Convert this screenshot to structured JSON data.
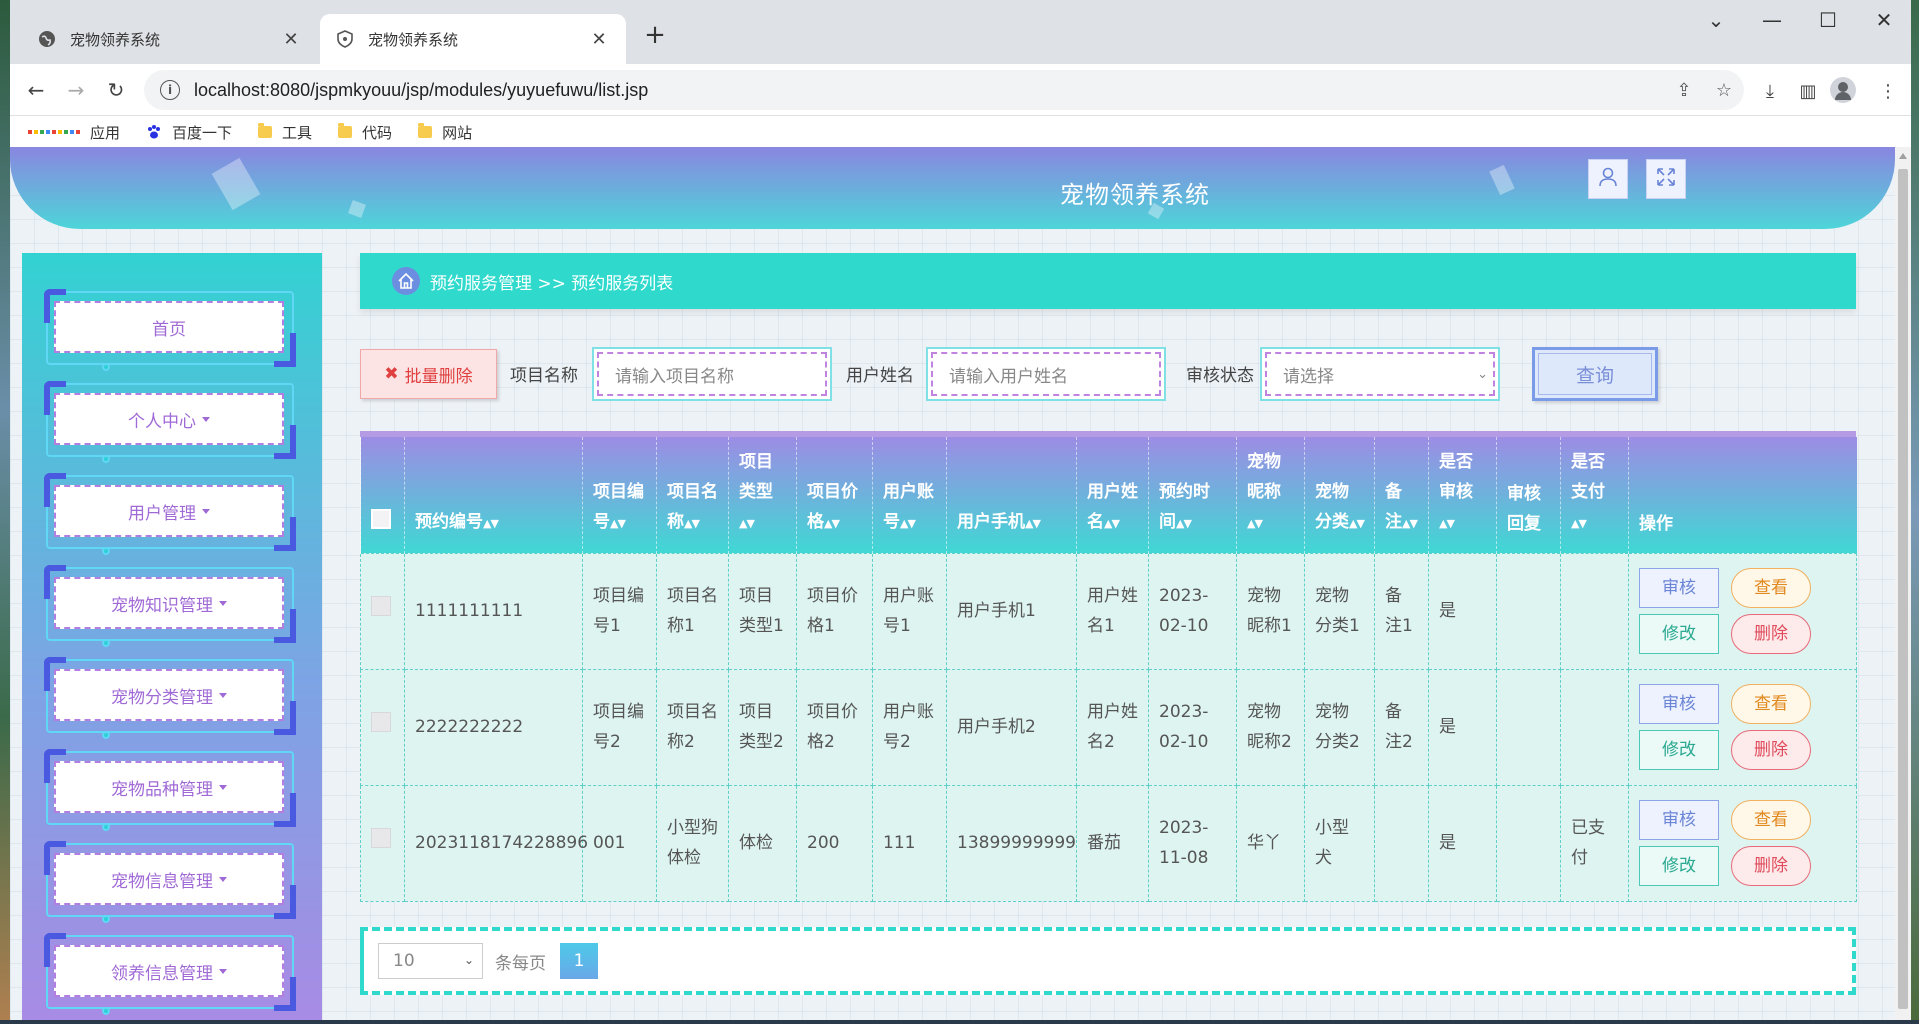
{
  "browser": {
    "tabs": [
      {
        "title": "宠物领养系统",
        "active": false
      },
      {
        "title": "宠物领养系统",
        "active": true
      }
    ],
    "url": "localhost:8080/jspmkyouu/jsp/modules/yuyuefuwu/list.jsp",
    "bookmarks": [
      "应用",
      "百度一下",
      "工具",
      "代码",
      "网站"
    ]
  },
  "app": {
    "title": "宠物领养系统"
  },
  "sidebar": {
    "items": [
      {
        "label": "首页",
        "dropdown": false
      },
      {
        "label": "个人中心",
        "dropdown": true
      },
      {
        "label": "用户管理",
        "dropdown": true
      },
      {
        "label": "宠物知识管理",
        "dropdown": true
      },
      {
        "label": "宠物分类管理",
        "dropdown": true
      },
      {
        "label": "宠物品种管理",
        "dropdown": true
      },
      {
        "label": "宠物信息管理",
        "dropdown": true
      },
      {
        "label": "领养信息管理",
        "dropdown": true
      }
    ]
  },
  "breadcrumb": {
    "text": "预约服务管理 >> 预约服务列表"
  },
  "search": {
    "batch_delete": "批量删除",
    "project_name_label": "项目名称",
    "project_name_placeholder": "请输入项目名称",
    "user_name_label": "用户姓名",
    "user_name_placeholder": "请输入用户姓名",
    "status_label": "审核状态",
    "status_placeholder": "请选择",
    "query_button": "查询"
  },
  "table": {
    "headers": [
      {
        "label": "预约编号",
        "sort": true
      },
      {
        "label": "项目编号",
        "sort": true
      },
      {
        "label": "项目名称",
        "sort": true
      },
      {
        "label": "项目类型",
        "sort": true
      },
      {
        "label": "项目价格",
        "sort": true
      },
      {
        "label": "用户账号",
        "sort": true
      },
      {
        "label": "用户手机",
        "sort": true
      },
      {
        "label": "用户姓名",
        "sort": true
      },
      {
        "label": "预约时间",
        "sort": true
      },
      {
        "label": "宠物昵称",
        "sort": true
      },
      {
        "label": "宠物分类",
        "sort": true
      },
      {
        "label": "备注",
        "sort": true
      },
      {
        "label": "是否审核",
        "sort": true
      },
      {
        "label": "审核回复",
        "sort": false
      },
      {
        "label": "是否支付",
        "sort": true
      },
      {
        "label": "操作",
        "sort": false
      }
    ],
    "rows": [
      [
        "1111111111",
        "项目编号1",
        "项目名称1",
        "项目类型1",
        "项目价格1",
        "用户账号1",
        "用户手机1",
        "用户姓名1",
        "2023-02-10",
        "宠物昵称1",
        "宠物分类1",
        "备注1",
        "是",
        "",
        ""
      ],
      [
        "2222222222",
        "项目编号2",
        "项目名称2",
        "项目类型2",
        "项目价格2",
        "用户账号2",
        "用户手机2",
        "用户姓名2",
        "2023-02-10",
        "宠物昵称2",
        "宠物分类2",
        "备注2",
        "是",
        "",
        ""
      ],
      [
        "2023118174228896",
        "001",
        "小型狗体检",
        "体检",
        "200",
        "111",
        "13899999999",
        "番茄",
        "2023-11-08",
        "华丫",
        "小型犬",
        "",
        "是",
        "",
        "已支付"
      ]
    ],
    "actions": {
      "audit": "审核",
      "view": "查看",
      "edit": "修改",
      "delete": "删除"
    }
  },
  "pager": {
    "page_size": "10",
    "per_page_label": "条每页",
    "current_page": "1"
  },
  "colors": {
    "accent": "#2fdacd",
    "purple": "#a06ad6",
    "header_gradient_top": "#9d8ce4",
    "header_gradient_bottom": "#3fd8d4"
  }
}
